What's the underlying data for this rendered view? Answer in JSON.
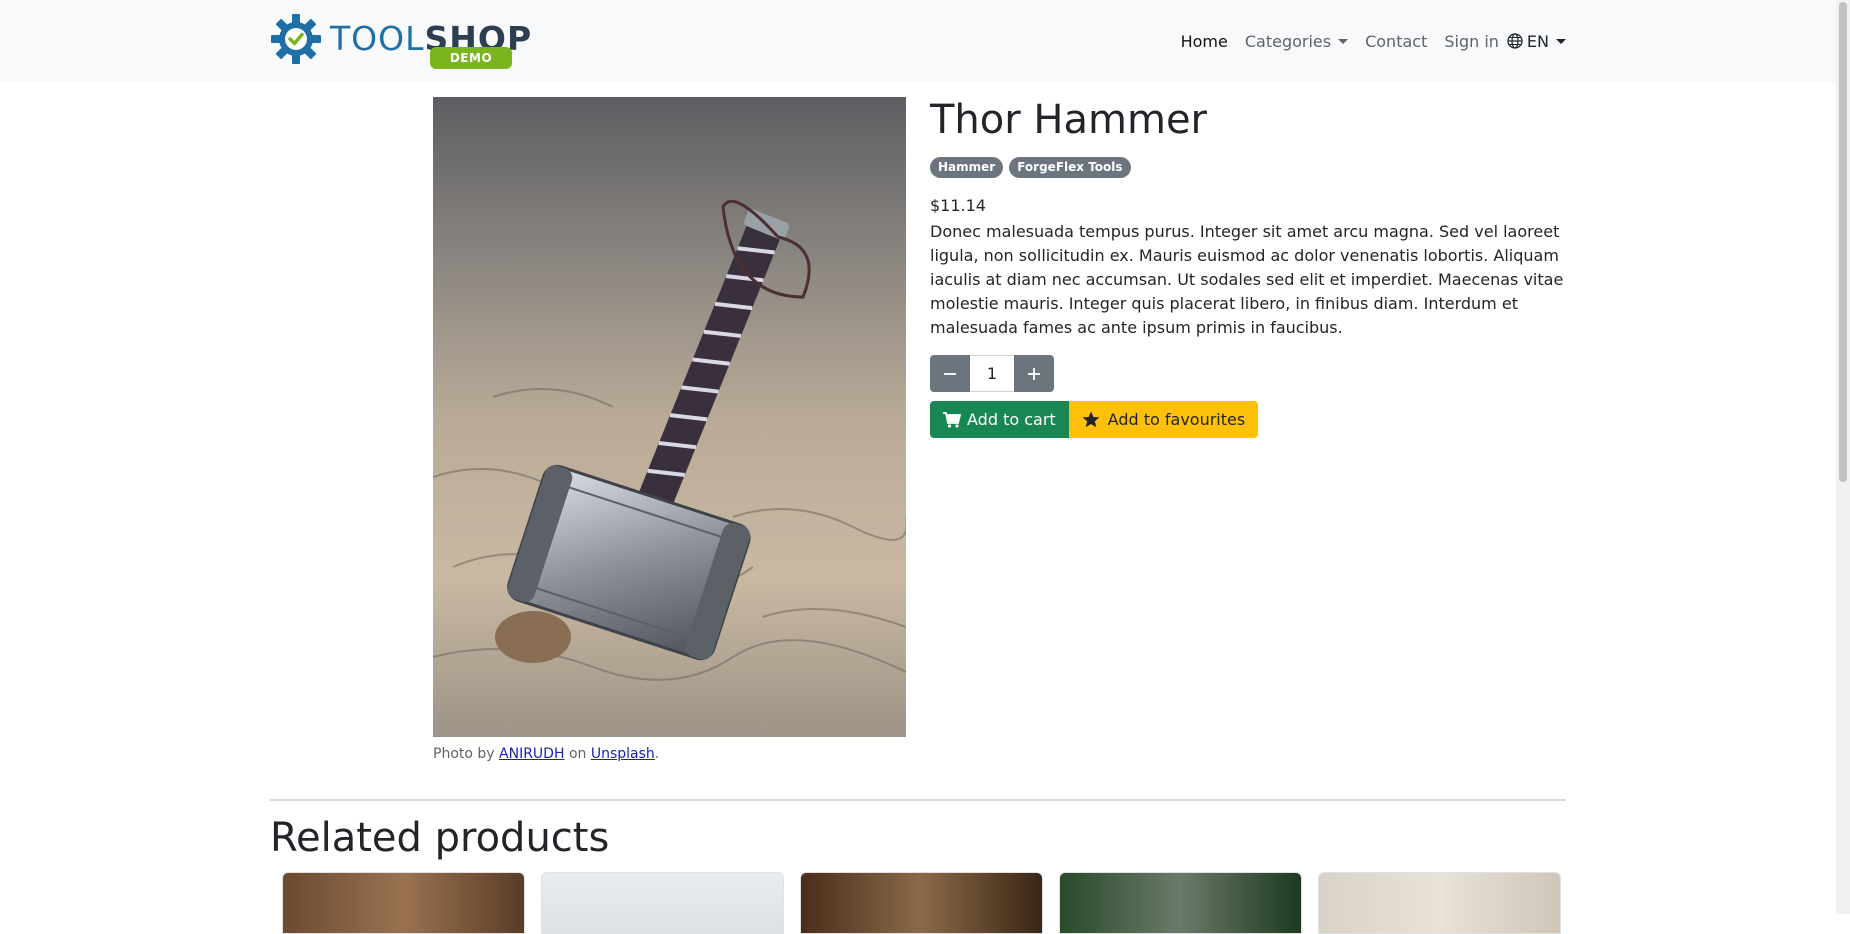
{
  "nav": {
    "logo_tool": "TOOL",
    "logo_shop": "SHOP",
    "logo_demo": "DEMO",
    "links": [
      {
        "label": "Home",
        "active": true
      },
      {
        "label": "Categories",
        "dropdown": true
      },
      {
        "label": "Contact"
      },
      {
        "label": "Sign in"
      }
    ],
    "language": "EN"
  },
  "product": {
    "title": "Thor Hammer",
    "badges": [
      "Hammer",
      "ForgeFlex Tools"
    ],
    "price": "$11.14",
    "description": "Donec malesuada tempus purus. Integer sit amet arcu magna. Sed vel laoreet ligula, non sollicitudin ex. Mauris euismod ac dolor venenatis lobortis. Aliquam iaculis at diam nec accumsan. Ut sodales sed elit et imperdiet. Maecenas vitae molestie mauris. Integer quis placerat libero, in finibus diam. Interdum et malesuada fames ac ante ipsum primis in faucibus.",
    "quantity": "1",
    "add_to_cart": "Add to cart",
    "add_to_favourites": "Add to favourites",
    "photo_credit": {
      "prefix": "Photo by",
      "author": "ANIRUDH",
      "middle": "on",
      "site": "Unsplash",
      "suffix": "."
    }
  },
  "related": {
    "title": "Related products"
  },
  "colors": {
    "navbar_bg": "#f8f9fa",
    "cart_green": "#198754",
    "fav_yellow": "#ffc107",
    "badge_gray": "#6c757d",
    "logo_blue": "#1f6fa7",
    "logo_green": "#7ab51d"
  }
}
